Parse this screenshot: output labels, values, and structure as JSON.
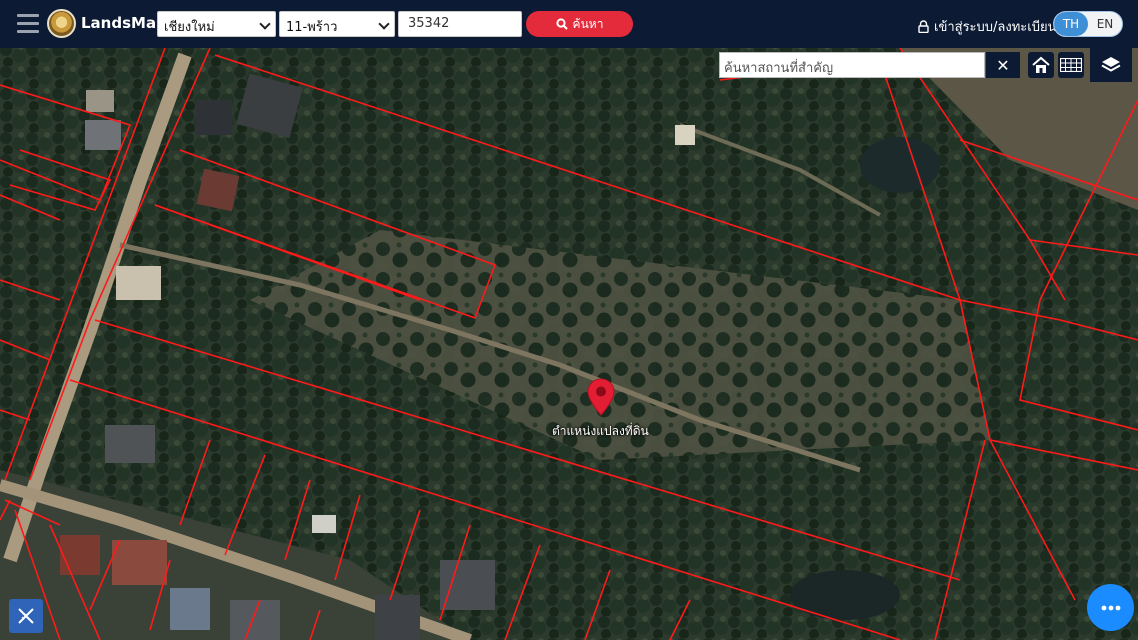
{
  "header": {
    "brand": "LandsMaps",
    "province_select": "เชียงใหม่",
    "district_select": "11-พร้าว",
    "parcel_number": "35342",
    "search_label": "ค้นหา",
    "login_label": "เข้าสู่ระบบ/ลงทะเบียน",
    "lang_th": "TH",
    "lang_en": "EN"
  },
  "map": {
    "place_search_placeholder": "ค้นหาสถานที่สำคัญ",
    "pin_label": "ตำแหน่งแปลงที่ดิน",
    "pin_color": "#e31e34",
    "parcel_line_color": "#ff1a1a"
  },
  "icons": {
    "menu": "hamburger-icon",
    "logo": "department-of-lands-seal",
    "search": "search-icon",
    "lock": "lock-icon",
    "clear": "close-icon",
    "home": "home-icon",
    "grid": "grid-icon",
    "layers": "layers-icon",
    "measure": "ruler-pencil-icon",
    "more": "more-dots-icon"
  }
}
